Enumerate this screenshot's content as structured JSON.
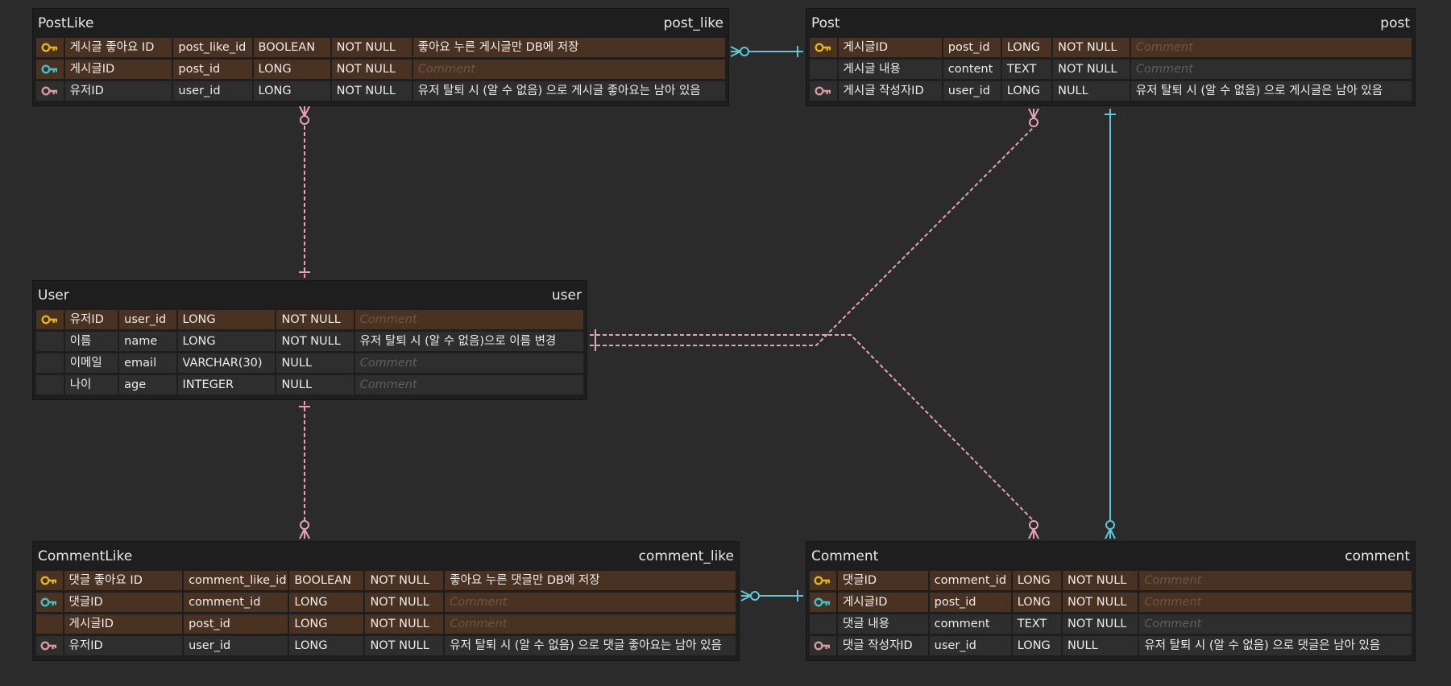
{
  "colors": {
    "background": "#2b2b2b",
    "table_bg": "#1e1e1e",
    "key_row": "#4a3222",
    "plain_row": "#2e2e2e",
    "pk_icon": "#e0b423",
    "fk_icon": "#3cc3c8",
    "ref_icon": "#d79aa0",
    "rel_pink": "#e5a3b4",
    "rel_cyan": "#63c6d6"
  },
  "placeholder_comment": "Comment",
  "tables": {
    "post_like": {
      "name": "PostLike",
      "physical": "post_like",
      "rows": [
        {
          "icon": "pk-icon",
          "key": true,
          "logical": "게시글 좋아요 ID",
          "column": "post_like_id",
          "type": "BOOLEAN",
          "nullable": "NOT NULL",
          "comment": "좋아요 누른 게시글만 DB에 저장"
        },
        {
          "icon": "fk-icon",
          "key": true,
          "logical": "게시글ID",
          "column": "post_id",
          "type": "LONG",
          "nullable": "NOT NULL",
          "comment": ""
        },
        {
          "icon": "ref-icon",
          "key": false,
          "logical": "유저ID",
          "column": "user_id",
          "type": "LONG",
          "nullable": "NOT NULL",
          "comment": "유저 탈퇴 시 (알 수 없음) 으로 게시글 좋아요는 남아 있음"
        }
      ]
    },
    "post": {
      "name": "Post",
      "physical": "post",
      "rows": [
        {
          "icon": "pk-icon",
          "key": true,
          "logical": "게시글ID",
          "column": "post_id",
          "type": "LONG",
          "nullable": "NOT NULL",
          "comment": ""
        },
        {
          "icon": "",
          "key": false,
          "logical": "게시글 내용",
          "column": "content",
          "type": "TEXT",
          "nullable": "NOT NULL",
          "comment": ""
        },
        {
          "icon": "ref-icon",
          "key": false,
          "logical": "게시글 작성자ID",
          "column": "user_id",
          "type": "LONG",
          "nullable": "NULL",
          "comment": "유저 탈퇴 시 (알 수 없음) 으로 게시글은 남아 있음"
        }
      ]
    },
    "user": {
      "name": "User",
      "physical": "user",
      "rows": [
        {
          "icon": "pk-icon",
          "key": true,
          "logical": "유저ID",
          "column": "user_id",
          "type": "LONG",
          "nullable": "NOT NULL",
          "comment": ""
        },
        {
          "icon": "",
          "key": false,
          "logical": "이름",
          "column": "name",
          "type": "LONG",
          "nullable": "NOT NULL",
          "comment": "유저 탈퇴 시 (알 수 없음)으로 이름 변경"
        },
        {
          "icon": "",
          "key": false,
          "logical": "이메일",
          "column": "email",
          "type": "VARCHAR(30)",
          "nullable": "NULL",
          "comment": ""
        },
        {
          "icon": "",
          "key": false,
          "logical": "나이",
          "column": "age",
          "type": "INTEGER",
          "nullable": "NULL",
          "comment": ""
        }
      ]
    },
    "comment_like": {
      "name": "CommentLike",
      "physical": "comment_like",
      "rows": [
        {
          "icon": "pk-icon",
          "key": true,
          "logical": "댓글 좋아요 ID",
          "column": "comment_like_id",
          "type": "BOOLEAN",
          "nullable": "NOT NULL",
          "comment": "좋아요 누른 댓글만 DB에 저장"
        },
        {
          "icon": "fk-icon",
          "key": true,
          "logical": "댓글ID",
          "column": "comment_id",
          "type": "LONG",
          "nullable": "NOT NULL",
          "comment": ""
        },
        {
          "icon": "",
          "key": true,
          "logical": "게시글ID",
          "column": "post_id",
          "type": "LONG",
          "nullable": "NOT NULL",
          "comment": ""
        },
        {
          "icon": "ref-icon",
          "key": false,
          "logical": "유저ID",
          "column": "user_id",
          "type": "LONG",
          "nullable": "NOT NULL",
          "comment": "유저 탈퇴 시 (알 수 없음) 으로 댓글 좋아요는 남아 있음"
        }
      ]
    },
    "comment": {
      "name": "Comment",
      "physical": "comment",
      "rows": [
        {
          "icon": "pk-icon",
          "key": true,
          "logical": "댓글ID",
          "column": "comment_id",
          "type": "LONG",
          "nullable": "NOT NULL",
          "comment": ""
        },
        {
          "icon": "fk-icon",
          "key": true,
          "logical": "게시글ID",
          "column": "post_id",
          "type": "LONG",
          "nullable": "NOT NULL",
          "comment": ""
        },
        {
          "icon": "",
          "key": false,
          "logical": "댓글 내용",
          "column": "comment",
          "type": "TEXT",
          "nullable": "NOT NULL",
          "comment": ""
        },
        {
          "icon": "ref-icon",
          "key": false,
          "logical": "댓글 작성자ID",
          "column": "user_id",
          "type": "LONG",
          "nullable": "NULL",
          "comment": "유저 탈퇴 시 (알 수 없음) 으로 댓글은 남아 있음"
        }
      ]
    }
  }
}
